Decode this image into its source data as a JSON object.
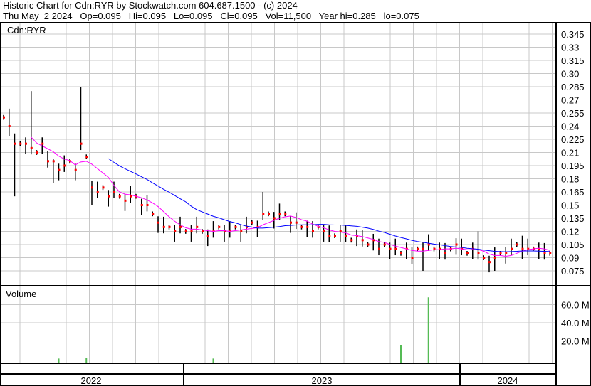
{
  "header": {
    "title": "Historic Chart for Cdn:RYR by Stockwatch.com 604.687.1500 - (c) 2024",
    "quote": "Thu May  2 2024   Op=0.095   Hi=0.095   Lo=0.095   Cl=0.095   Vol=11,500   Year hi=0.285   lo=0.075"
  },
  "chart_data": {
    "type": "line",
    "symbol_label": "Cdn:RYR",
    "volume_label": "Volume",
    "price_ticks": [
      "0.345",
      "0.33",
      "0.315",
      "0.30",
      "0.285",
      "0.27",
      "0.255",
      "0.24",
      "0.225",
      "0.21",
      "0.195",
      "0.18",
      "0.165",
      "0.15",
      "0.135",
      "0.12",
      "0.105",
      "0.09",
      "0.075"
    ],
    "ylim": [
      0.075,
      0.345
    ],
    "volume_ticks": [
      "60.0 M",
      "40.0 M",
      "20.0 M"
    ],
    "volume_ylim": [
      0,
      70
    ],
    "years": [
      "2022",
      "2023",
      "2024"
    ],
    "colors": {
      "bars": "#000000",
      "close": "#ff0000",
      "ma_short": "#ff00ff",
      "ma_long": "#0000ff",
      "volume": "#55bb55",
      "grid": "#c8c8c8"
    },
    "ma_periods": [
      6,
      20
    ],
    "closes": [
      0.25,
      0.24,
      0.22,
      0.22,
      0.22,
      0.215,
      0.21,
      0.22,
      0.2,
      0.2,
      0.19,
      0.195,
      0.2,
      0.19,
      0.22,
      0.205,
      0.17,
      0.165,
      0.17,
      0.16,
      0.165,
      0.16,
      0.155,
      0.16,
      0.16,
      0.15,
      0.15,
      0.14,
      0.13,
      0.125,
      0.125,
      0.12,
      0.125,
      0.12,
      0.12,
      0.125,
      0.12,
      0.115,
      0.12,
      0.125,
      0.12,
      0.12,
      0.125,
      0.12,
      0.125,
      0.13,
      0.125,
      0.14,
      0.14,
      0.135,
      0.14,
      0.14,
      0.13,
      0.13,
      0.125,
      0.125,
      0.12,
      0.125,
      0.12,
      0.115,
      0.115,
      0.12,
      0.115,
      0.11,
      0.115,
      0.11,
      0.105,
      0.11,
      0.1,
      0.105,
      0.1,
      0.1,
      0.095,
      0.1,
      0.09,
      0.1,
      0.1,
      0.105,
      0.1,
      0.1,
      0.095,
      0.1,
      0.105,
      0.1,
      0.095,
      0.1,
      0.095,
      0.09,
      0.085,
      0.09,
      0.095,
      0.095,
      0.1,
      0.105,
      0.1,
      0.1,
      0.1,
      0.1,
      0.095,
      0.095
    ],
    "spread": 0.009,
    "high_overrides": {
      "1": 0.26,
      "5": 0.28,
      "14": 0.285,
      "47": 0.165,
      "86": 0.12,
      "94": 0.115
    },
    "low_overrides": {
      "2": 0.16,
      "9": 0.175,
      "16": 0.15,
      "76": 0.075,
      "89": 0.075
    },
    "volume_millions": {
      "10": 0.5,
      "15": 1,
      "38": 0.5,
      "72": 15,
      "77": 68
    }
  }
}
